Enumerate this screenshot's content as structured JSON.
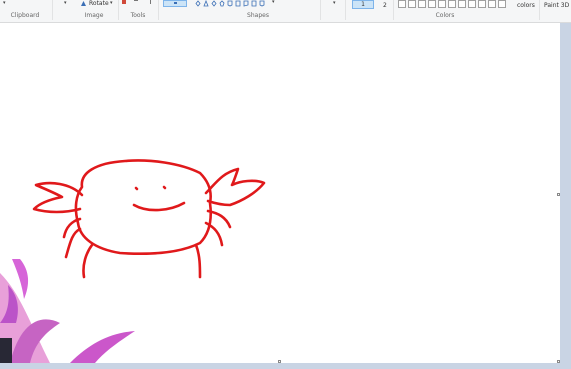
{
  "ribbon": {
    "groups": {
      "clipboard": "Clipboard",
      "image": "Image",
      "tools": "Tools",
      "shapes": "Shapes",
      "colors": "Colors"
    },
    "rotate_label": "Rotate",
    "rotate_dropdown": "▾",
    "color1_label": "1",
    "color2_label": "2",
    "edit_colors_label": "colors",
    "paint3d_label": "Paint 3D"
  },
  "icons": {
    "rotate": "rotate-icon",
    "shapes": "shapes-gallery-icon",
    "resize_handle": "resize-handle-icon"
  },
  "drawing": {
    "stroke_color": "#e0191b",
    "subject": "crab-doodle"
  },
  "colors": {
    "canvas_bg": "#ffffff",
    "workspace_bg": "#c9d4e4",
    "ribbon_bg": "#f5f6f7",
    "accent": "#cce4f7"
  }
}
